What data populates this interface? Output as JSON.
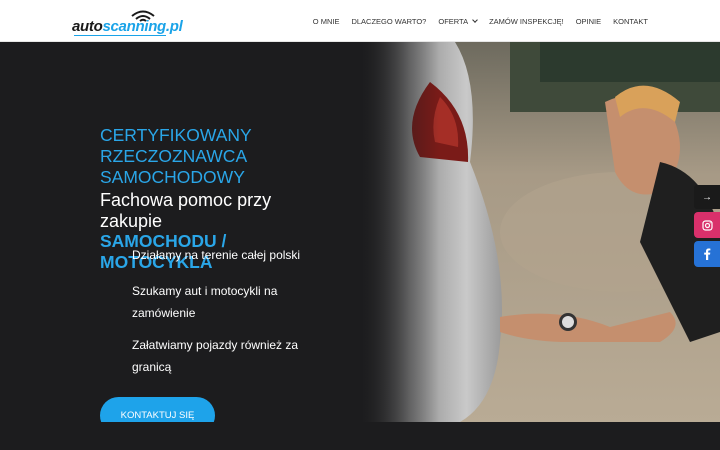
{
  "header": {
    "logo": {
      "part1": "auto",
      "part2": "scanning.pl"
    },
    "nav": [
      {
        "label": "O MNIE"
      },
      {
        "label": "DLACZEGO WARTO?"
      },
      {
        "label": "OFERTA",
        "has_dropdown": true
      },
      {
        "label": "ZAMÓW INSPEKCJĘ!"
      },
      {
        "label": "OPINIE"
      },
      {
        "label": "KONTAKT"
      }
    ]
  },
  "hero": {
    "heading_lines": [
      "CERTYFIKOWANY",
      "RZECZOZNAWCA",
      "SAMOCHODOWY"
    ],
    "subheading": "Fachowa pomoc przy zakupie",
    "subheading_strong_lines": [
      "SAMOCHODU /",
      "MOTOCYKLA"
    ],
    "bullets": [
      "Działamy na terenie całej polski",
      "Szukamy aut i motocykli na zamówienie",
      "Załatwiamy pojazdy również za granicą"
    ],
    "cta_label": "KONTAKTUJ SIĘ"
  },
  "side_bar": {
    "icons": [
      "arrow-right-icon",
      "instagram-icon",
      "facebook-icon"
    ],
    "colors": {
      "instagram": "#d9306b",
      "facebook": "#2672d6"
    }
  },
  "colors": {
    "accent": "#2aa6e8",
    "background": "#1c1c1e",
    "header": "#ffffff"
  }
}
